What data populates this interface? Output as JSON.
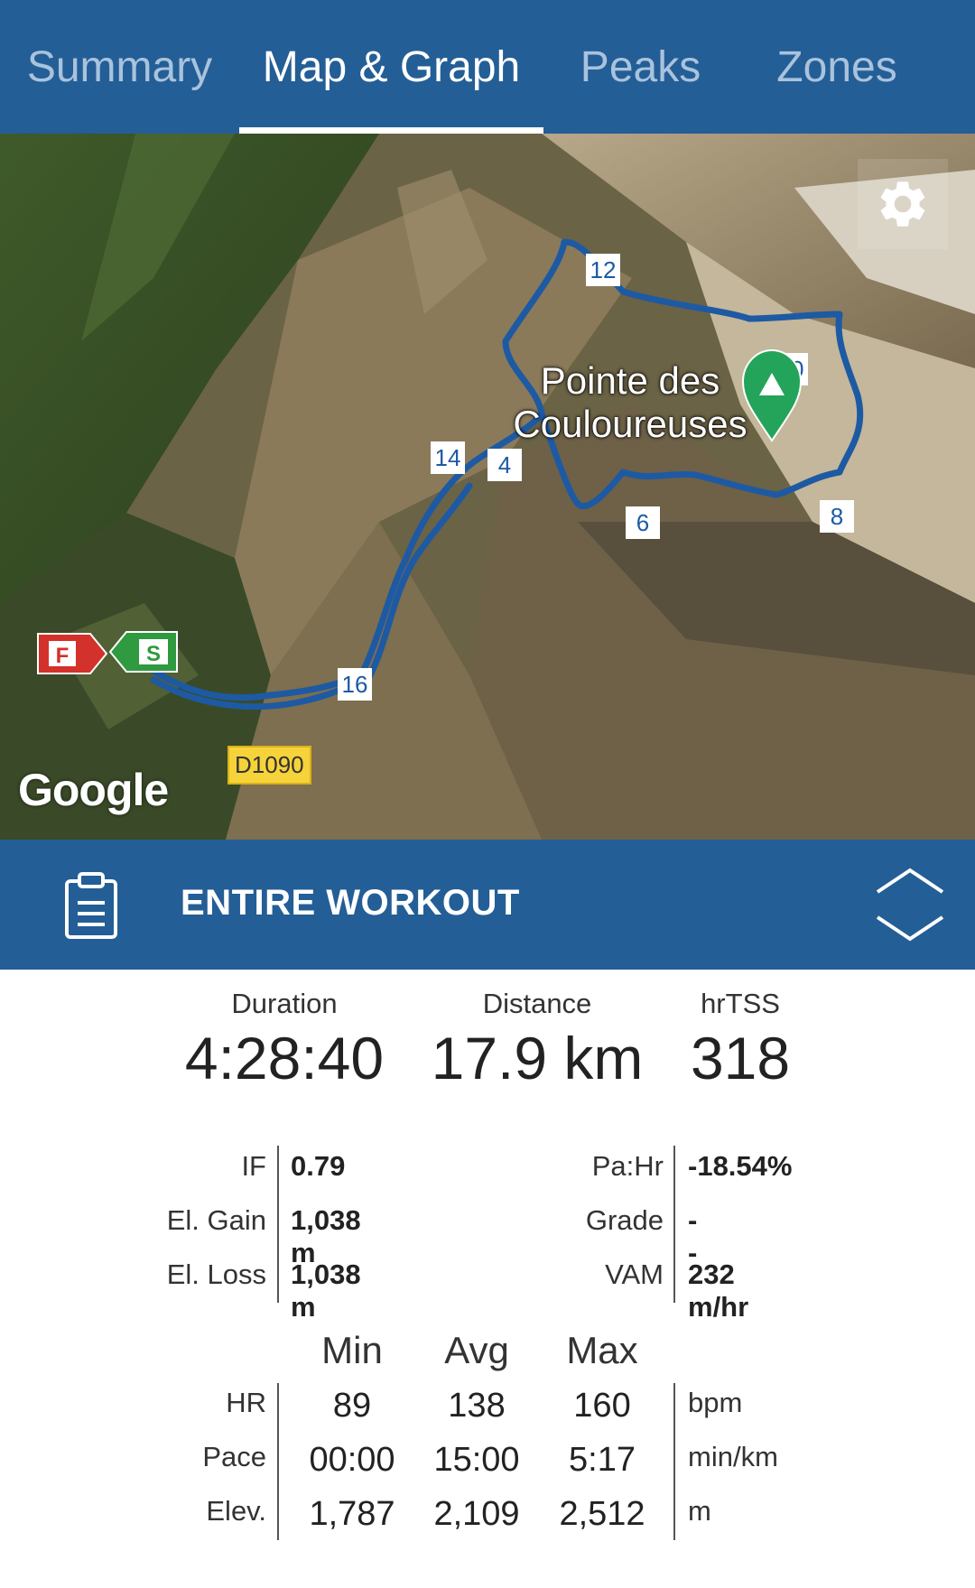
{
  "tabs": [
    {
      "label": "Summary",
      "active": false
    },
    {
      "label": "Map & Graph",
      "active": true
    },
    {
      "label": "Peaks",
      "active": false
    },
    {
      "label": "Zones",
      "active": false
    }
  ],
  "map": {
    "peak_label": "Pointe des Couloureuses",
    "markers": [
      "12",
      "10",
      "14",
      "4",
      "6",
      "8",
      "16"
    ],
    "start_marker": "S",
    "finish_marker": "F",
    "road_label": "D1090",
    "attribution": "Google",
    "route_color": "#1d5aa3",
    "icons": [
      "settings-gear-icon",
      "peak-marker-icon",
      "start-flag-icon",
      "finish-flag-icon"
    ]
  },
  "section": {
    "title": "ENTIRE WORKOUT",
    "icons": [
      "clipboard-icon",
      "expand-collapse-icon"
    ]
  },
  "summary": {
    "duration": {
      "label": "Duration",
      "value": "4:28:40"
    },
    "distance": {
      "label": "Distance",
      "value": "17.9 km"
    },
    "hrtss": {
      "label": "hrTSS",
      "value": "318"
    },
    "left_stats": [
      {
        "label": "IF",
        "value": "0.79"
      },
      {
        "label": "El. Gain",
        "value": "1,038 m"
      },
      {
        "label": "El. Loss",
        "value": "1,038 m"
      }
    ],
    "right_stats": [
      {
        "label": "Pa:Hr",
        "value": "-18.54%"
      },
      {
        "label": "Grade",
        "value": "--"
      },
      {
        "label": "VAM",
        "value": "232 m/hr"
      }
    ],
    "grid": {
      "headers": [
        "Min",
        "Avg",
        "Max"
      ],
      "rows": [
        {
          "label": "HR",
          "min": "89",
          "avg": "138",
          "max": "160",
          "unit": "bpm"
        },
        {
          "label": "Pace",
          "min": "00:00",
          "avg": "15:00",
          "max": "5:17",
          "unit": "min/km"
        },
        {
          "label": "Elev.",
          "min": "1,787",
          "avg": "2,109",
          "max": "2,512",
          "unit": "m"
        }
      ]
    }
  }
}
